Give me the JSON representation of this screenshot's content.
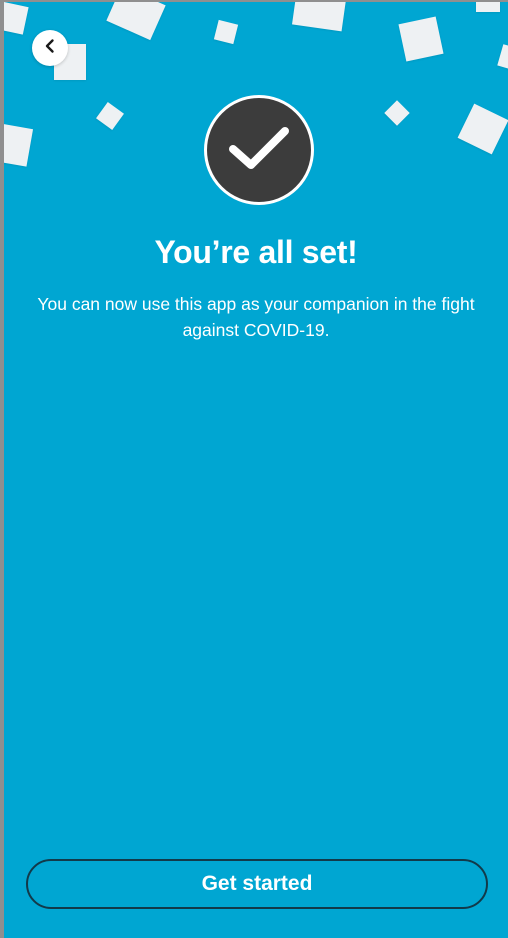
{
  "header": {
    "back_icon": "chevron-left-icon"
  },
  "success": {
    "icon": "checkmark-icon",
    "title": "You’re all set!",
    "message": "You can now use this app as your companion in the fight against COVID-19."
  },
  "actions": {
    "get_started_label": "Get started"
  },
  "colors": {
    "background": "#00a6d2",
    "confetti": "#eef1f3",
    "check_circle": "#3c3c3c",
    "button_border": "#123a4a",
    "text": "#ffffff"
  }
}
